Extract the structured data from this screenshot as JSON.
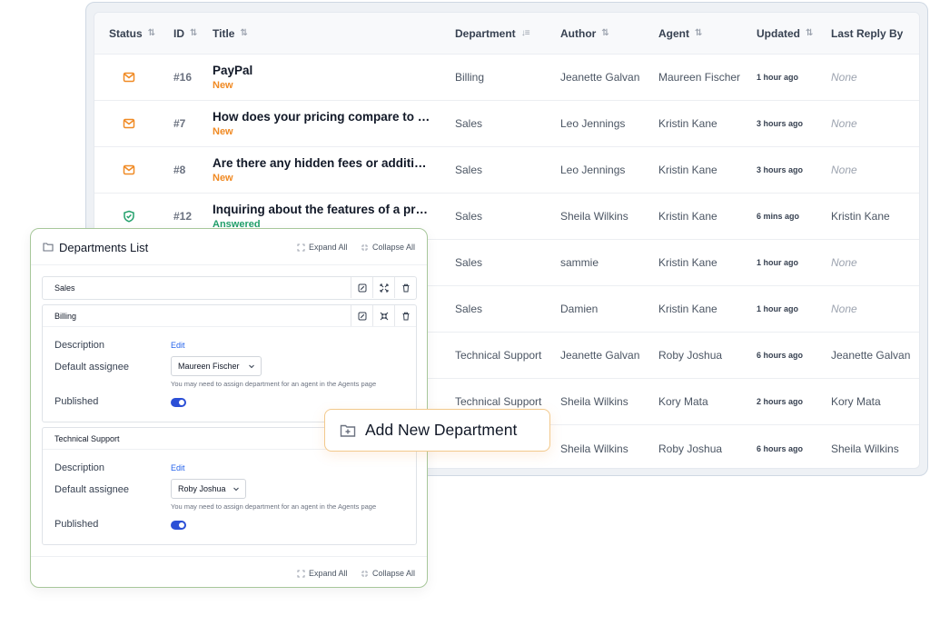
{
  "table": {
    "headers": {
      "status": "Status",
      "id": "ID",
      "title": "Title",
      "department": "Department",
      "author": "Author",
      "agent": "Agent",
      "updated": "Updated",
      "last_reply": "Last Reply By"
    },
    "rows": [
      {
        "status_icon": "envelope-icon",
        "id": "#16",
        "title": "PayPal",
        "state": "New",
        "department": "Billing",
        "author": "Jeanette Galvan",
        "agent": "Maureen Fischer",
        "updated": "1 hour ago",
        "last_reply": "None"
      },
      {
        "status_icon": "envelope-icon",
        "id": "#7",
        "title": "How does your pricing compare to …",
        "state": "New",
        "department": "Sales",
        "author": "Leo Jennings",
        "agent": "Kristin Kane",
        "updated": "3 hours ago",
        "last_reply": "None"
      },
      {
        "status_icon": "envelope-icon",
        "id": "#8",
        "title": "Are there any hidden fees or additi…",
        "state": "New",
        "department": "Sales",
        "author": "Leo Jennings",
        "agent": "Kristin Kane",
        "updated": "3 hours ago",
        "last_reply": "None"
      },
      {
        "status_icon": "check-shield-icon",
        "id": "#12",
        "title": "Inquiring about the features of a pr…",
        "state": "Answered",
        "department": "Sales",
        "author": "Sheila Wilkins",
        "agent": "Kristin Kane",
        "updated": "6 mins ago",
        "last_reply": "Kristin Kane"
      },
      {
        "department": "Sales",
        "author": "sammie",
        "agent": "Kristin Kane",
        "updated": "1 hour ago",
        "last_reply": "None"
      },
      {
        "department": "Sales",
        "author": "Damien",
        "agent": "Kristin Kane",
        "updated": "1 hour ago",
        "last_reply": "None"
      },
      {
        "department": "Technical Support",
        "author": "Jeanette Galvan",
        "agent": "Roby Joshua",
        "updated": "6 hours ago",
        "last_reply": "Jeanette Galvan"
      },
      {
        "department": "Technical Support",
        "author": "Sheila Wilkins",
        "agent": "Kory Mata",
        "updated": "2 hours ago",
        "last_reply": "Kory Mata"
      },
      {
        "department": "",
        "author": "Sheila Wilkins",
        "agent": "Roby Joshua",
        "updated": "6 hours ago",
        "last_reply": "Sheila Wilkins"
      }
    ]
  },
  "departments": {
    "title": "Departments List",
    "expand_all": "Expand All",
    "collapse_all": "Collapse All",
    "sales": {
      "name": "Sales"
    },
    "billing": {
      "name": "Billing",
      "description_label": "Description",
      "edit": "Edit",
      "assignee_label": "Default assignee",
      "assignee": "Maureen Fischer",
      "hint": "You may need to assign department for an agent in the Agents page",
      "published_label": "Published",
      "published": true
    },
    "tech": {
      "name": "Technical Support",
      "description_label": "Description",
      "edit": "Edit",
      "assignee_label": "Default assignee",
      "assignee": "Roby Joshua",
      "hint": "You may need to assign department for an agent in the Agents page",
      "published_label": "Published",
      "published": true
    }
  },
  "add_button": {
    "label": "Add New Department",
    "icon": "folder-plus-icon"
  },
  "colors": {
    "accent": "#2b4fd6",
    "new": "#f08a24",
    "answered": "#22a06b",
    "card_border": "#a7c79a"
  }
}
